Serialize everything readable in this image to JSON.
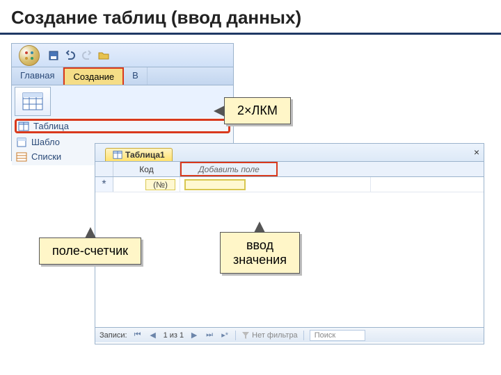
{
  "slide": {
    "title": "Создание таблиц (ввод данных)"
  },
  "ribbon": {
    "tabs": {
      "home": "Главная",
      "create": "Создание",
      "other": "В"
    }
  },
  "nav_pane": {
    "tablitsa": "Таблица",
    "shablo": "Шабло",
    "spiski": "Списки"
  },
  "datasheet": {
    "tab_label": "Таблица1",
    "close": "×",
    "cols": {
      "kod": "Код",
      "add": "Добавить поле"
    },
    "row_marker": "*",
    "cell_kod_value": "(№)"
  },
  "status": {
    "records_label": "Записи:",
    "pos": "1 из 1",
    "filter": "Нет фильтра",
    "search": "Поиск"
  },
  "callouts": {
    "lkm": "2×ЛКМ",
    "counter": "поле-счетчик",
    "value_line1": "ввод",
    "value_line2": "значения"
  }
}
